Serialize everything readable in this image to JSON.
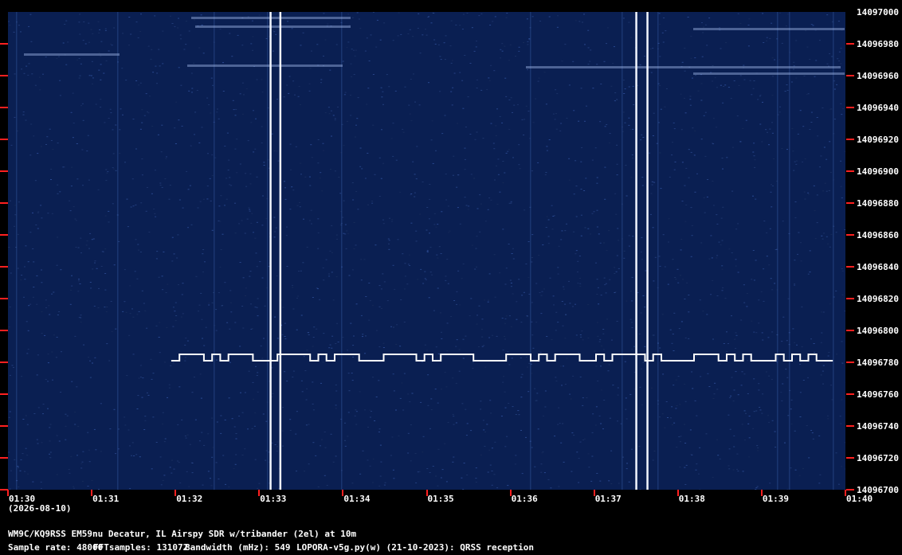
{
  "window": {
    "station_line": "WM9C/KQ9RSS EM59nu Decatur, IL  Airspy SDR w/tribander (2el) at 10m",
    "sample_rate": "Sample rate: 48000",
    "fft_samples": "FFTsamples: 131072",
    "bandwidth": "Bandwidth (mHz): 549",
    "software": "LOPORA-v5g.py(w) (21-10-2023): QRSS reception",
    "date": "(2026-08-10)"
  },
  "colors": {
    "background": "#000000",
    "plot_bg": "#0a1f52",
    "tick": "#ff2020",
    "signal": "#ffffff"
  },
  "chart_data": {
    "type": "heatmap",
    "title": "",
    "xlabel": "",
    "ylabel": "",
    "x_ticks": [
      "01:30",
      "01:31",
      "01:32",
      "01:33",
      "01:34",
      "01:35",
      "01:36",
      "01:37",
      "01:38",
      "01:39",
      "01:40"
    ],
    "y_ticks": [
      "14097000",
      "14096980",
      "14096960",
      "14096940",
      "14096920",
      "14096900",
      "14096880",
      "14096860",
      "14096840",
      "14096820",
      "14096800",
      "14096780",
      "14096760",
      "14096740",
      "14096720",
      "14096700"
    ],
    "ylim": [
      14096700,
      14097000
    ],
    "xlim": [
      "01:30",
      "01:40"
    ],
    "grid": false,
    "signals": [
      {
        "name": "fsk-cw",
        "start": "01:31:57",
        "end": "01:39:51",
        "low_hz": 14096781,
        "high_hz": 14096785
      },
      {
        "name": "vertical-line",
        "time": "01:33:08"
      },
      {
        "name": "vertical-line",
        "time": "01:33:15"
      },
      {
        "name": "vertical-line",
        "time": "01:37:30"
      },
      {
        "name": "vertical-line",
        "time": "01:37:38"
      }
    ]
  }
}
